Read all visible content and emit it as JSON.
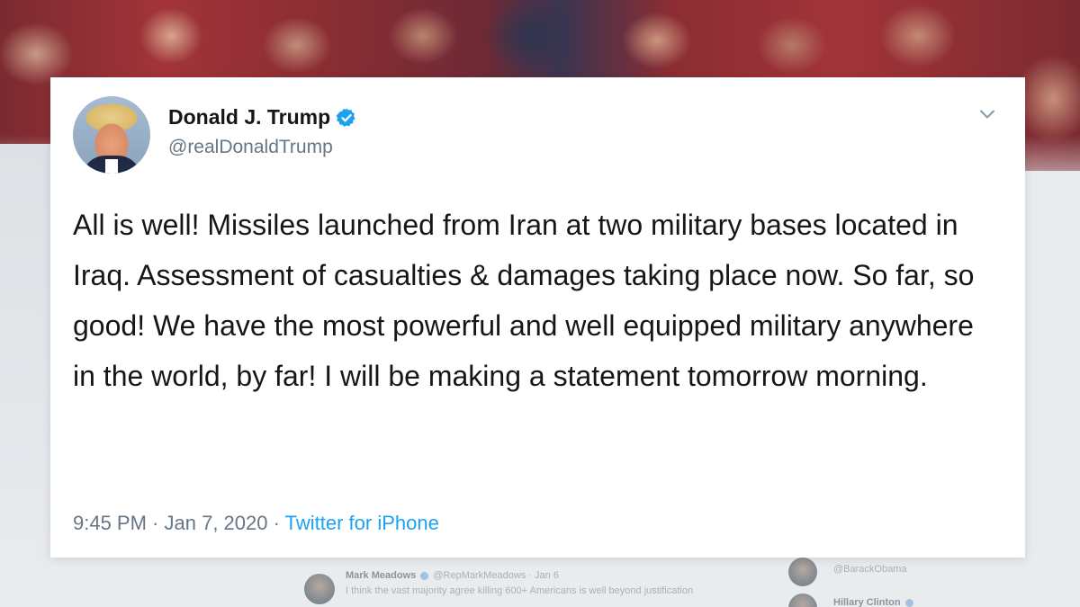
{
  "tweet": {
    "display_name": "Donald J. Trump",
    "handle": "@realDonaldTrump",
    "text": "All is well! Missiles launched from Iran at two military bases located in Iraq. Assessment of casualties & damages taking place now. So far, so good! We have the most powerful and well equipped military anywhere in the world, by far! I will be making a statement tomorrow morning.",
    "time": "9:45 PM",
    "separator": " · ",
    "date": "Jan 7, 2020",
    "source": "Twitter for iPhone",
    "verified": true
  },
  "background_tweets": {
    "row1_name": "Mark Meadows",
    "row1_handle": "@RepMarkMeadows · Jan 6",
    "row1_text": "I think the vast majority agree killing 600+ Americans is well beyond justification",
    "row2_handle": "@BarackObama",
    "row3_name": "Hillary Clinton"
  },
  "colors": {
    "link_blue": "#1da1f2",
    "text_primary": "#14171a",
    "text_secondary": "#657786",
    "card_bg": "#ffffff"
  },
  "icons": {
    "verified": "verified-badge-icon",
    "menu": "chevron-down-icon"
  }
}
